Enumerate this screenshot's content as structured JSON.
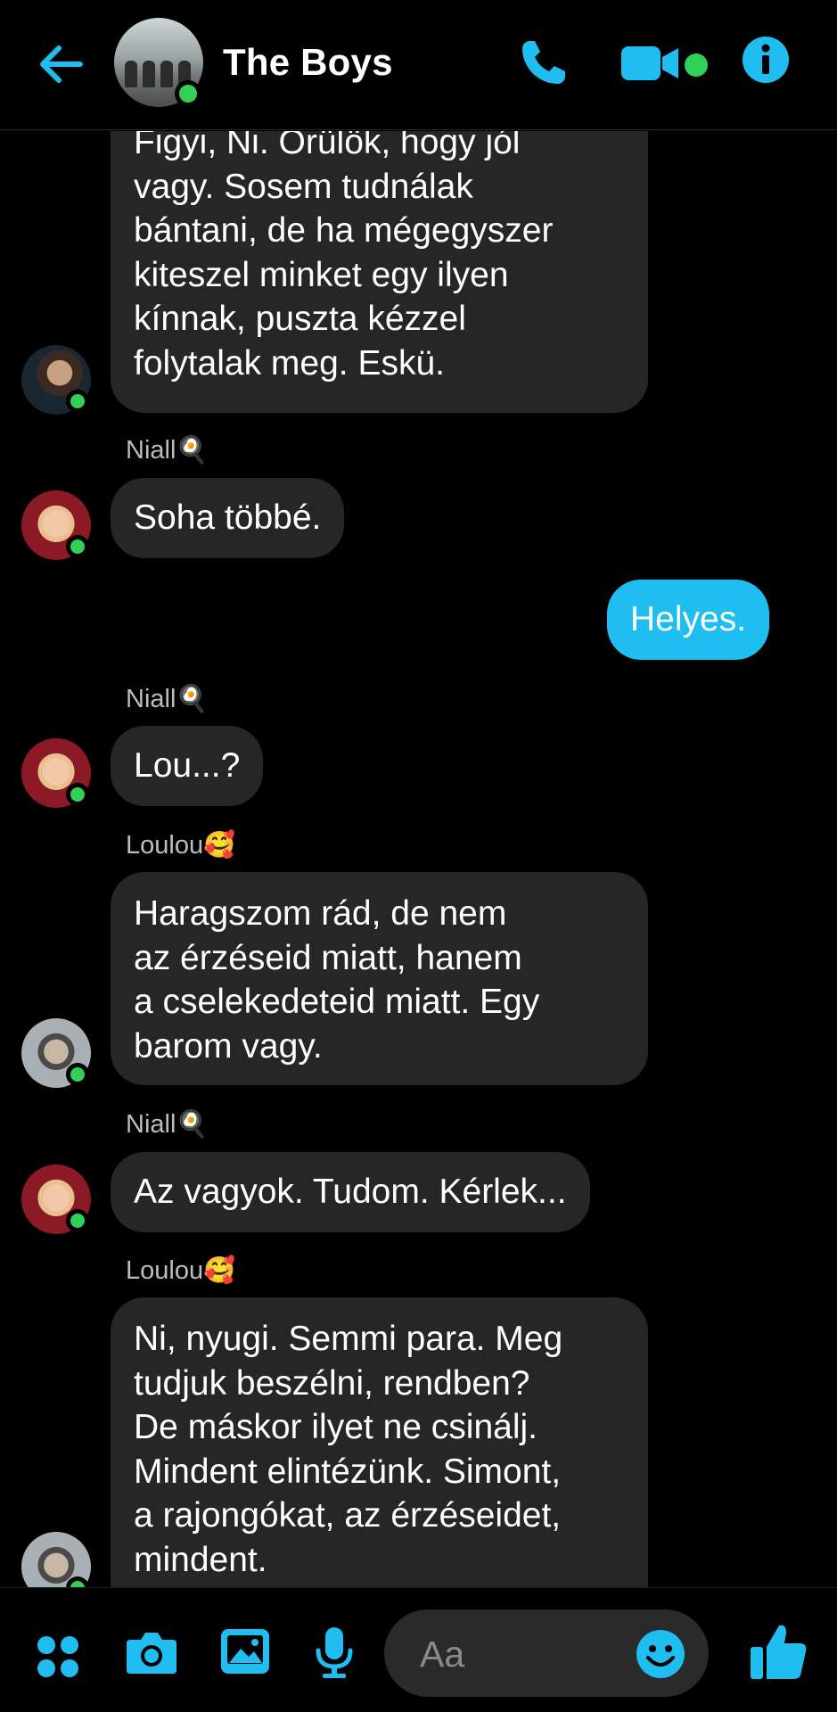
{
  "header": {
    "title": "The Boys",
    "accent_color": "#1fbdf0",
    "online_color": "#31d158"
  },
  "messages": [
    {
      "type": "incoming",
      "sender": "",
      "avatar": "a",
      "text": "Figyi, Ni. Örülök, hogy jól\nvagy. Sosem tudnálak\nbántani, de ha mégegyszer\nkiteszel minket egy ilyen\nkínnak, puszta kézzel\nfolytalak meg. Eskü."
    },
    {
      "type": "incoming",
      "sender": "Niall🍳",
      "avatar": "n",
      "text": "Soha többé."
    },
    {
      "type": "outgoing",
      "sender": "",
      "avatar": "",
      "text": "Helyes."
    },
    {
      "type": "incoming",
      "sender": "Niall🍳",
      "avatar": "n",
      "text": "Lou...?"
    },
    {
      "type": "incoming",
      "sender": "Loulou🥰",
      "avatar": "l",
      "text": "Haragszom rád, de nem\naz érzéseid miatt, hanem\na cselekedeteid miatt. Egy\nbarom vagy."
    },
    {
      "type": "incoming",
      "sender": "Niall🍳",
      "avatar": "n",
      "text": "Az vagyok. Tudom. Kérlek..."
    },
    {
      "type": "incoming",
      "sender": "Loulou🥰",
      "avatar": "l",
      "text": "Ni, nyugi. Semmi para. Meg\ntudjuk beszélni, rendben?\nDe máskor ilyet ne csinálj.\nMindent elintézünk. Simont,\na rajongókat, az érzéseidet,\nmindent."
    }
  ],
  "composer": {
    "placeholder": "Aa",
    "icons": [
      "apps-icon",
      "camera-icon",
      "image-icon",
      "microphone-icon",
      "emoji-icon",
      "thumbs-up-icon"
    ]
  }
}
